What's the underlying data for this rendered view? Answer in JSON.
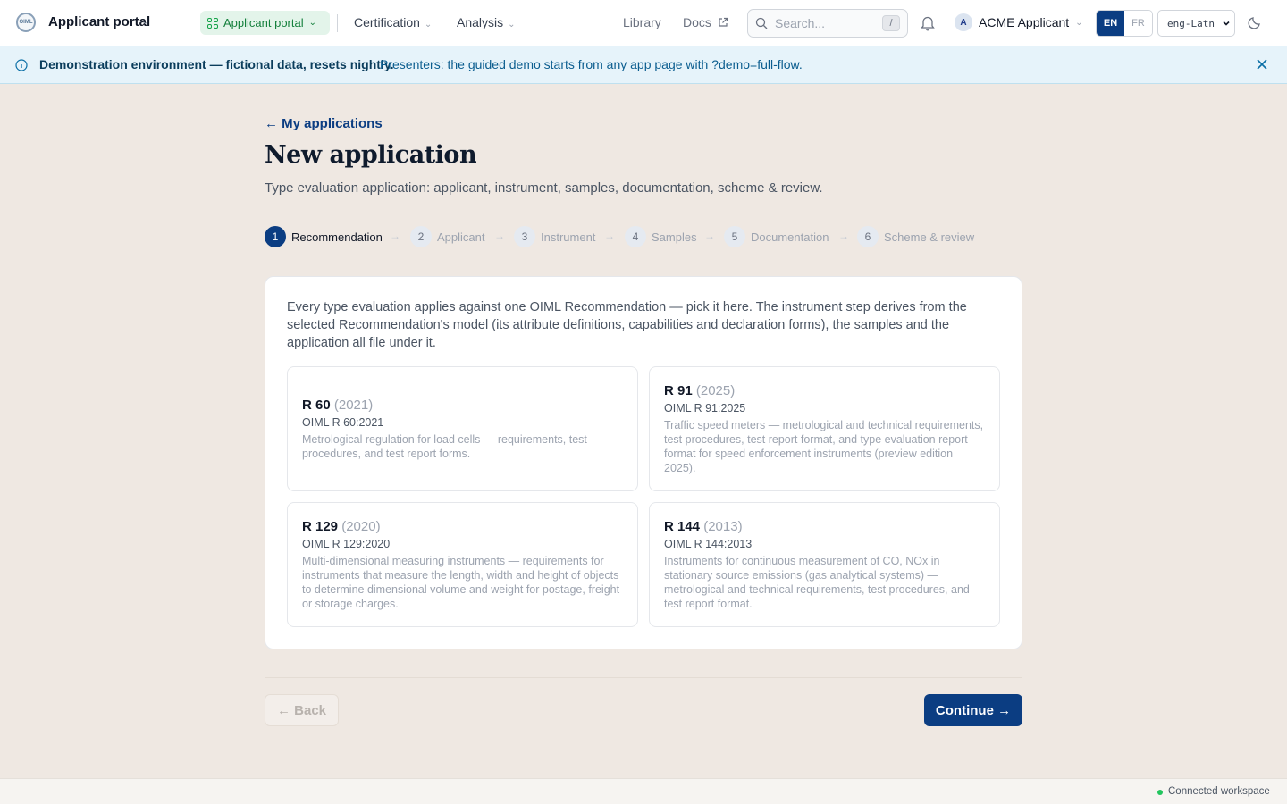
{
  "topbar": {
    "app_title": "Applicant portal",
    "portal_switcher": "Applicant portal",
    "nav": [
      {
        "label": "Certification"
      },
      {
        "label": "Analysis"
      }
    ],
    "library": "Library",
    "docs": "Docs",
    "search_placeholder": "Search...",
    "search_shortcut": "/",
    "user_initial": "A",
    "user_name": "ACME Applicant",
    "lang_en": "EN",
    "lang_fr": "FR",
    "script_value": "eng-Latn"
  },
  "banner": {
    "strong": "Demonstration environment — fictional data, resets nightly.",
    "text": "Presenters: the guided demo starts from any app page with ?demo=full-flow."
  },
  "main": {
    "back_link": "← My applications",
    "title": "New application",
    "subtitle": "Type evaluation application: applicant, instrument, samples, documentation, scheme & review."
  },
  "stepper": [
    {
      "num": "1",
      "label": "Recommendation",
      "active": true
    },
    {
      "num": "2",
      "label": "Applicant"
    },
    {
      "num": "3",
      "label": "Instrument"
    },
    {
      "num": "4",
      "label": "Samples"
    },
    {
      "num": "5",
      "label": "Documentation"
    },
    {
      "num": "6",
      "label": "Scheme & review"
    }
  ],
  "card": {
    "intro": "Every type evaluation applies against one OIML Recommendation — pick it here. The instrument step derives from the selected Recommendation's model (its attribute definitions, capabilities and declaration forms), the samples and the application all file under it.",
    "recommendations": [
      {
        "code": "R 60",
        "year": "(2021)",
        "ref": "OIML R 60:2021",
        "desc": "Metrological regulation for load cells — requirements, test procedures, and test report forms."
      },
      {
        "code": "R 91",
        "year": "(2025)",
        "ref": "OIML R 91:2025",
        "desc": "Traffic speed meters — metrological and technical requirements, test procedures, test report format, and type evaluation report format for speed enforcement instruments (preview edition 2025)."
      },
      {
        "code": "R 129",
        "year": "(2020)",
        "ref": "OIML R 129:2020",
        "desc": "Multi-dimensional measuring instruments — requirements for instruments that measure the length, width and height of objects to determine dimensional volume and weight for postage, freight or storage charges."
      },
      {
        "code": "R 144",
        "year": "(2013)",
        "ref": "OIML R 144:2013",
        "desc": "Instruments for continuous measurement of CO, NOx in stationary source emissions (gas analytical systems) — metrological and technical requirements, test procedures, and test report format."
      }
    ]
  },
  "footer": {
    "back": "← Back",
    "continue": "Continue →",
    "status": "Connected workspace"
  },
  "colors": {
    "primary": "#0b3d82",
    "background": "#efe8e2",
    "banner": "#e6f3fa",
    "success": "#22c55e"
  }
}
